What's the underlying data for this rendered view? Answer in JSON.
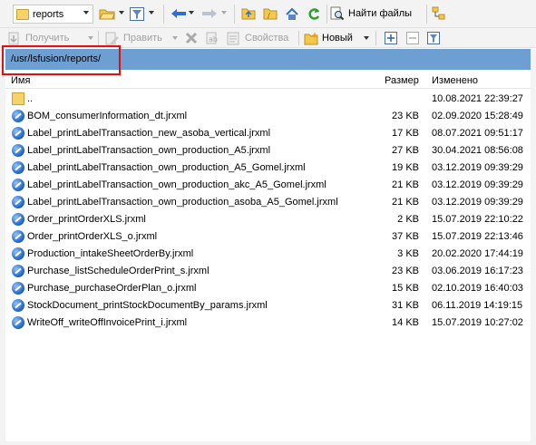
{
  "toolbar1": {
    "location": "reports",
    "find_label": "Найти файлы"
  },
  "toolbar2": {
    "get_label": "Получить",
    "edit_label": "Править",
    "properties_label": "Свойства",
    "new_label": "Новый"
  },
  "path": "/usr/lsfusion/reports/",
  "columns": {
    "name": "Имя",
    "size": "Размер",
    "modified": "Изменено"
  },
  "files": [
    {
      "name": "..",
      "size": "",
      "modified": "10.08.2021 22:39:27",
      "icon": "parent-folder-icon"
    },
    {
      "name": "BOM_consumerInformation_dt.jrxml",
      "size": "23 KB",
      "modified": "02.09.2020 15:28:49",
      "icon": "jrxml-icon"
    },
    {
      "name": "Label_printLabelTransaction_new_asoba_vertical.jrxml",
      "size": "17 KB",
      "modified": "08.07.2021 09:51:17",
      "icon": "jrxml-icon"
    },
    {
      "name": "Label_printLabelTransaction_own_production_A5.jrxml",
      "size": "27 KB",
      "modified": "30.04.2021 08:56:08",
      "icon": "jrxml-icon"
    },
    {
      "name": "Label_printLabelTransaction_own_production_A5_Gomel.jrxml",
      "size": "19 KB",
      "modified": "03.12.2019 09:39:29",
      "icon": "jrxml-icon"
    },
    {
      "name": "Label_printLabelTransaction_own_production_akc_A5_Gomel.jrxml",
      "size": "21 KB",
      "modified": "03.12.2019 09:39:29",
      "icon": "jrxml-icon"
    },
    {
      "name": "Label_printLabelTransaction_own_production_asoba_A5_Gomel.jrxml",
      "size": "21 KB",
      "modified": "03.12.2019 09:39:29",
      "icon": "jrxml-icon"
    },
    {
      "name": "Order_printOrderXLS.jrxml",
      "size": "2 KB",
      "modified": "15.07.2019 22:10:22",
      "icon": "jrxml-icon"
    },
    {
      "name": "Order_printOrderXLS_o.jrxml",
      "size": "37 KB",
      "modified": "15.07.2019 22:13:46",
      "icon": "jrxml-icon"
    },
    {
      "name": "Production_intakeSheetOrderBy.jrxml",
      "size": "3 KB",
      "modified": "20.02.2020 17:44:19",
      "icon": "jrxml-icon"
    },
    {
      "name": "Purchase_listScheduleOrderPrint_s.jrxml",
      "size": "23 KB",
      "modified": "03.06.2019 16:17:23",
      "icon": "jrxml-icon"
    },
    {
      "name": "Purchase_purchaseOrderPlan_o.jrxml",
      "size": "15 KB",
      "modified": "02.10.2019 16:40:03",
      "icon": "jrxml-icon"
    },
    {
      "name": "StockDocument_printStockDocumentBy_params.jrxml",
      "size": "31 KB",
      "modified": "06.11.2019 14:19:15",
      "icon": "jrxml-icon"
    },
    {
      "name": "WriteOff_writeOffInvoicePrint_i.jrxml",
      "size": "14 KB",
      "modified": "15.07.2019 10:27:02",
      "icon": "jrxml-icon"
    }
  ]
}
